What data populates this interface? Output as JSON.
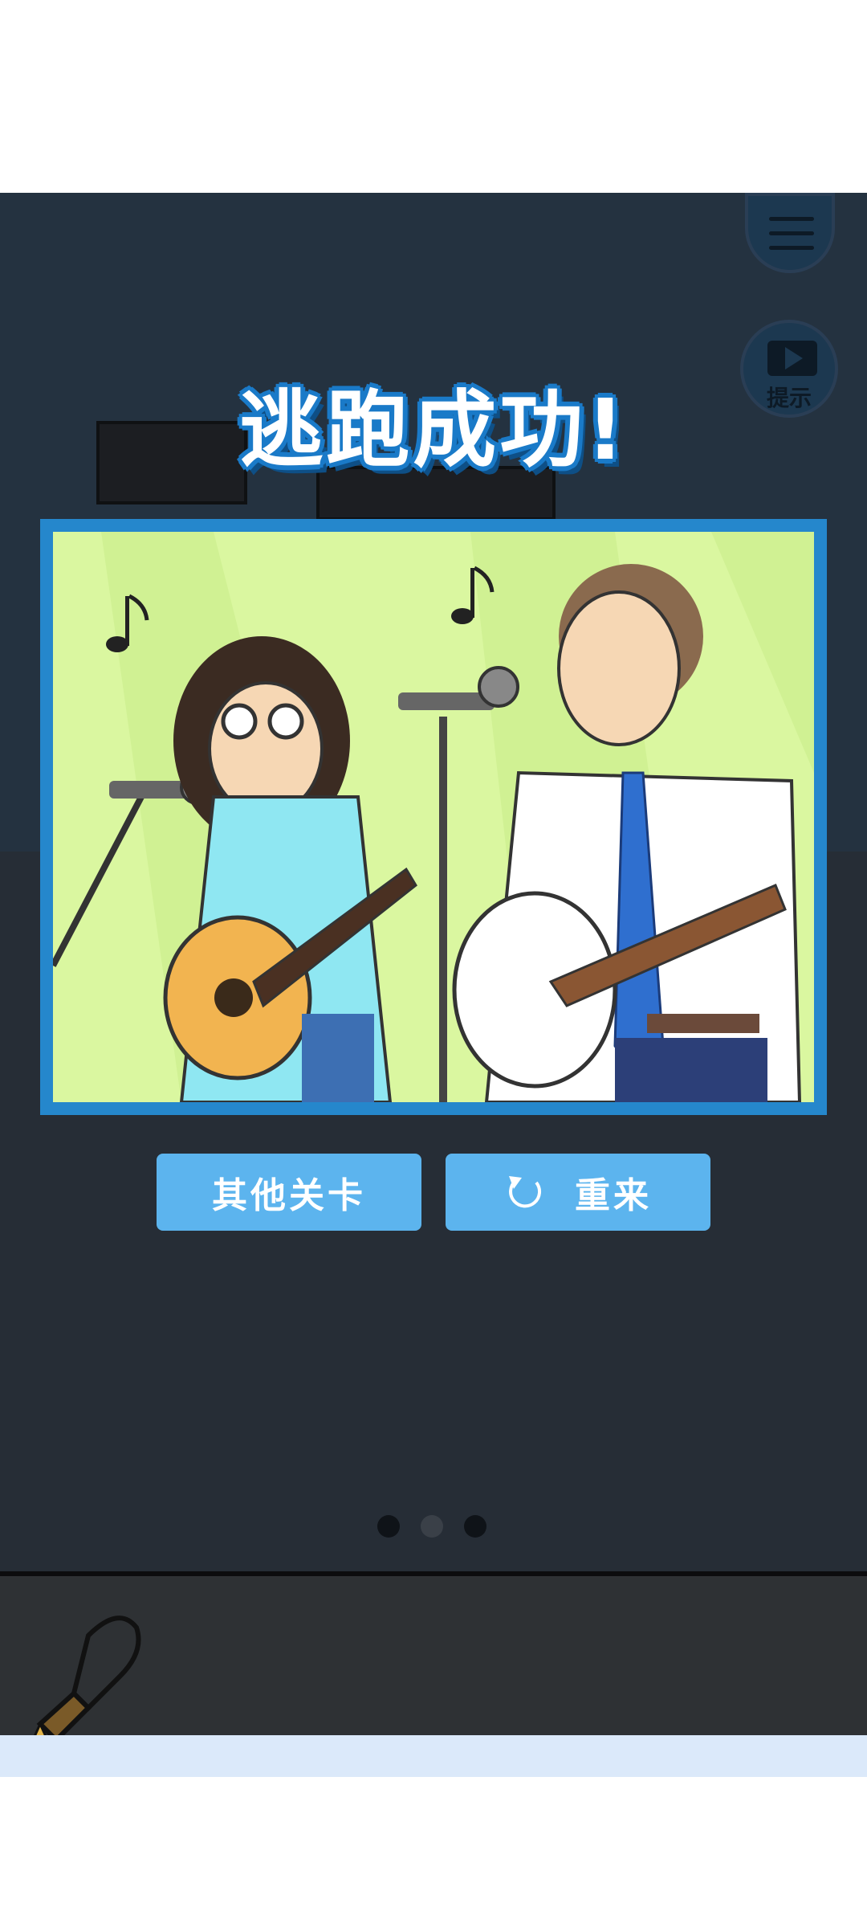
{
  "status": {
    "title": "逃跑成功!"
  },
  "menu": {
    "icon": "hamburger-menu-icon"
  },
  "hint": {
    "label": "提示",
    "icon": "video-play-icon"
  },
  "actions": {
    "other_levels_label": "其他关卡",
    "retry_label": "重来",
    "retry_icon": "refresh-icon"
  },
  "pager": {
    "count": 3,
    "active_index": 1
  },
  "inventory": {
    "items": [
      {
        "name": "machete",
        "icon": "machete-icon"
      }
    ]
  },
  "colors": {
    "accent": "#5cb4ee",
    "frame": "#2587cc",
    "background": "#262d36",
    "inventory_bg": "#2e3134",
    "bottom_bar": "#dbe9fa"
  }
}
